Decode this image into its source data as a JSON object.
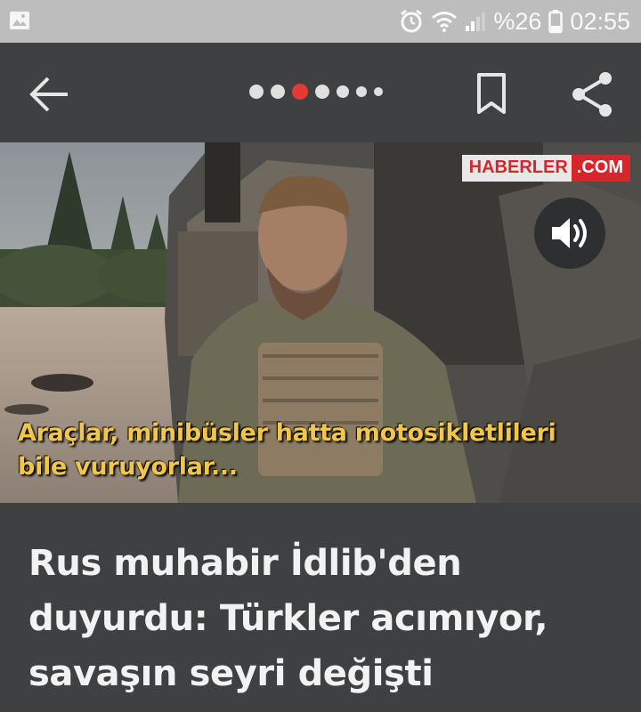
{
  "status_bar": {
    "battery_percent": "%26",
    "time": "02:55",
    "icons": [
      "image-icon",
      "alarm-icon",
      "wifi-icon",
      "signal-icon",
      "battery-icon"
    ]
  },
  "app_bar": {
    "icons": [
      "back-arrow-icon",
      "bookmark-icon",
      "share-icon"
    ],
    "pager": {
      "count": 7,
      "active_index": 2,
      "active_color": "#e53935",
      "inactive_color": "#e0e0e0"
    }
  },
  "media": {
    "brand_part1": "HABERLER",
    "brand_part2": ".COM",
    "brand_color": "#d7262b",
    "caption_line1": "Araçlar, minibüsler hatta motosikletlileri",
    "caption_line2": "bile vuruyorlar...",
    "caption_color": "#f2c64a",
    "sound_icon": "volume-icon"
  },
  "article": {
    "headline_line1": "Rus muhabir İdlib'den",
    "headline_line2": "duyurdu: Türkler acımıyor,",
    "headline_line3": "savaşın seyri değişti"
  }
}
